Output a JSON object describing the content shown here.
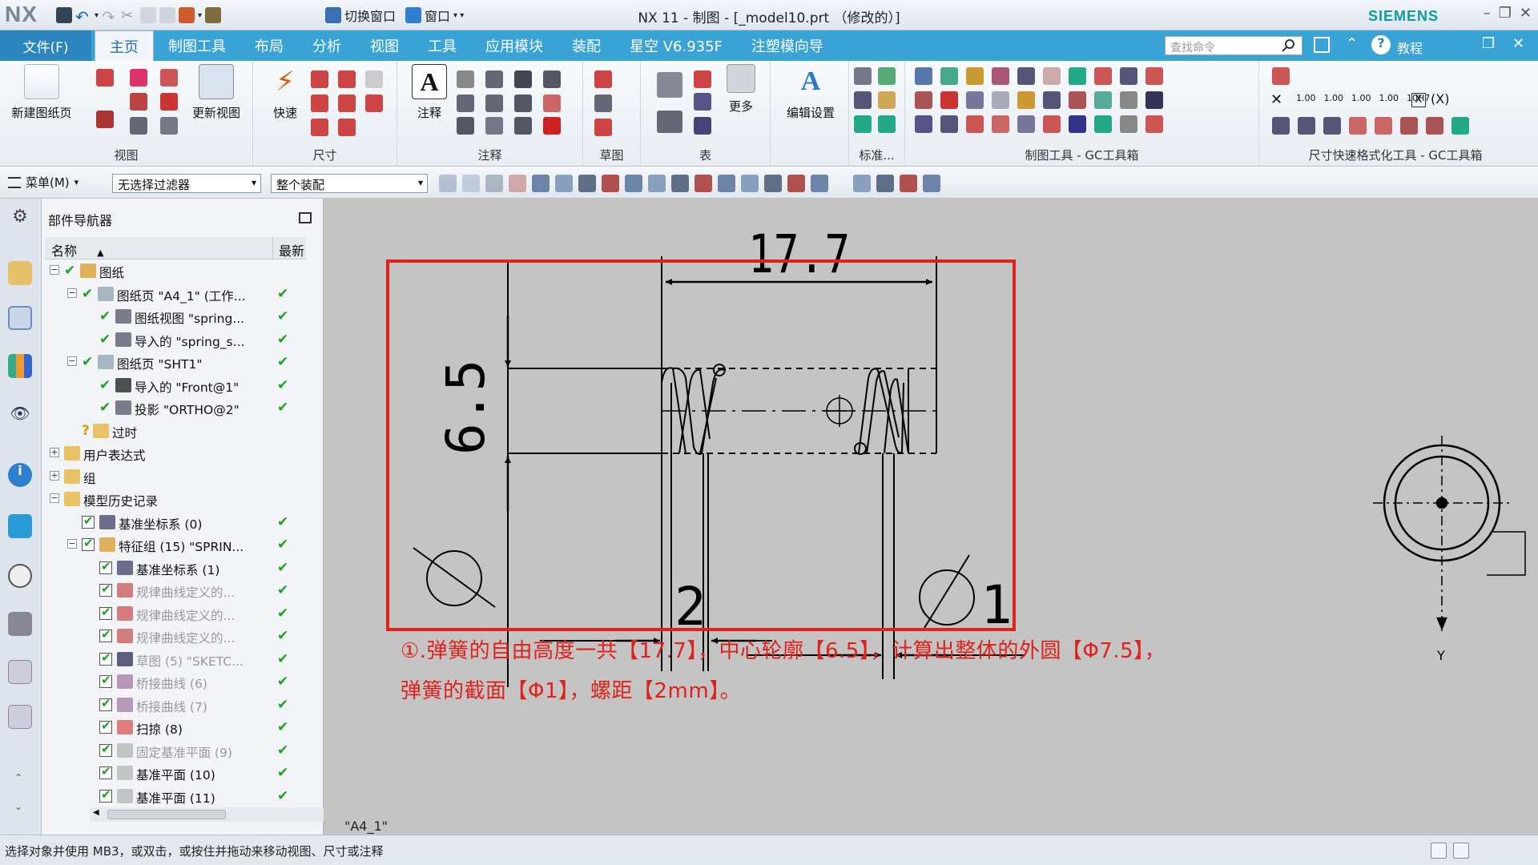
{
  "titlebar": {
    "logo": "NX",
    "switch_window": "切换窗口",
    "window_menu": "窗口",
    "title": "NX 11 - 制图 - [_model10.prt （修改的）]",
    "brand": "SIEMENS"
  },
  "menubar": {
    "file_label": "文件(F)",
    "tabs": [
      {
        "label": "主页"
      },
      {
        "label": "制图工具"
      },
      {
        "label": "布局"
      },
      {
        "label": "分析"
      },
      {
        "label": "视图"
      },
      {
        "label": "工具"
      },
      {
        "label": "应用模块"
      },
      {
        "label": "装配"
      },
      {
        "label": "星空 V6.935F"
      },
      {
        "label": "注塑模向导"
      }
    ],
    "search_placeholder": "查找命令",
    "tutorial_label": "教程"
  },
  "ribbon": {
    "new_sheet": "新建图纸页",
    "update_views": "更新视图",
    "group_view": "视图",
    "rapid": "快速",
    "group_dimension": "尺寸",
    "note": "注释",
    "group_annotation": "注释",
    "group_sketch": "草图",
    "more": "更多",
    "group_table": "表",
    "edit_settings": "编辑设置",
    "group_standard": "标准...",
    "group_drafting_tools": "制图工具 - GC工具箱",
    "group_dim_format": "尺寸快速格式化工具 - GC工具箱",
    "dim_fmt_labels": [
      "1.00",
      "1.00",
      "1.00",
      "1.00",
      "10H7"
    ]
  },
  "toolbar2": {
    "menu_label": "菜单(M)",
    "filter_value": "无选择过滤器",
    "scope_value": "整个装配"
  },
  "navigator": {
    "title": "部件导航器",
    "col_name": "名称",
    "col_latest": "最新",
    "rows": [
      {
        "label": "图纸"
      },
      {
        "label": "图纸页 \"A4_1\" (工作..."
      },
      {
        "label": "图纸视图 \"spring..."
      },
      {
        "label": "导入的 \"spring_s..."
      },
      {
        "label": "图纸页 \"SHT1\""
      },
      {
        "label": "导入的 \"Front@1\""
      },
      {
        "label": "投影 \"ORTHO@2\""
      },
      {
        "label": "过时"
      },
      {
        "label": "用户表达式"
      },
      {
        "label": "组"
      },
      {
        "label": "模型历史记录"
      },
      {
        "label": "基准坐标系 (0)"
      },
      {
        "label": "特征组 (15) \"SPRIN..."
      },
      {
        "label": "基准坐标系 (1)"
      },
      {
        "label": "规律曲线定义的..."
      },
      {
        "label": "规律曲线定义的..."
      },
      {
        "label": "规律曲线定义的..."
      },
      {
        "label": "草图 (5) \"SKETC..."
      },
      {
        "label": "桥接曲线 (6)"
      },
      {
        "label": "桥接曲线 (7)"
      },
      {
        "label": "扫掠 (8)"
      },
      {
        "label": "固定基准平面 (9)"
      },
      {
        "label": "基准平面 (10)"
      },
      {
        "label": "基准平面 (11)"
      }
    ]
  },
  "drawing": {
    "dim_height": "17.7",
    "dim_outer": "6.5",
    "dim_pitch": "2",
    "dim_wire": "1",
    "axis_label": "Y",
    "sheet_label": "\"A4_1\""
  },
  "caption": {
    "line1": "①.弹簧的自由高度一共【17.7】，中心轮廓【6.5】，计算出整体的外圆【Φ7.5】，",
    "line2": "弹簧的截面【Φ1】，螺距【2mm】。"
  },
  "status": {
    "text": "选择对象并使用 MB3，或双击，或按住并拖动来移动视图、尺寸或注释"
  },
  "colors": {
    "menubar": "#3aa3d6",
    "highlight_frame": "#e0211a",
    "check_green": "#19a11f",
    "siemens_teal": "#0d9aa2"
  }
}
